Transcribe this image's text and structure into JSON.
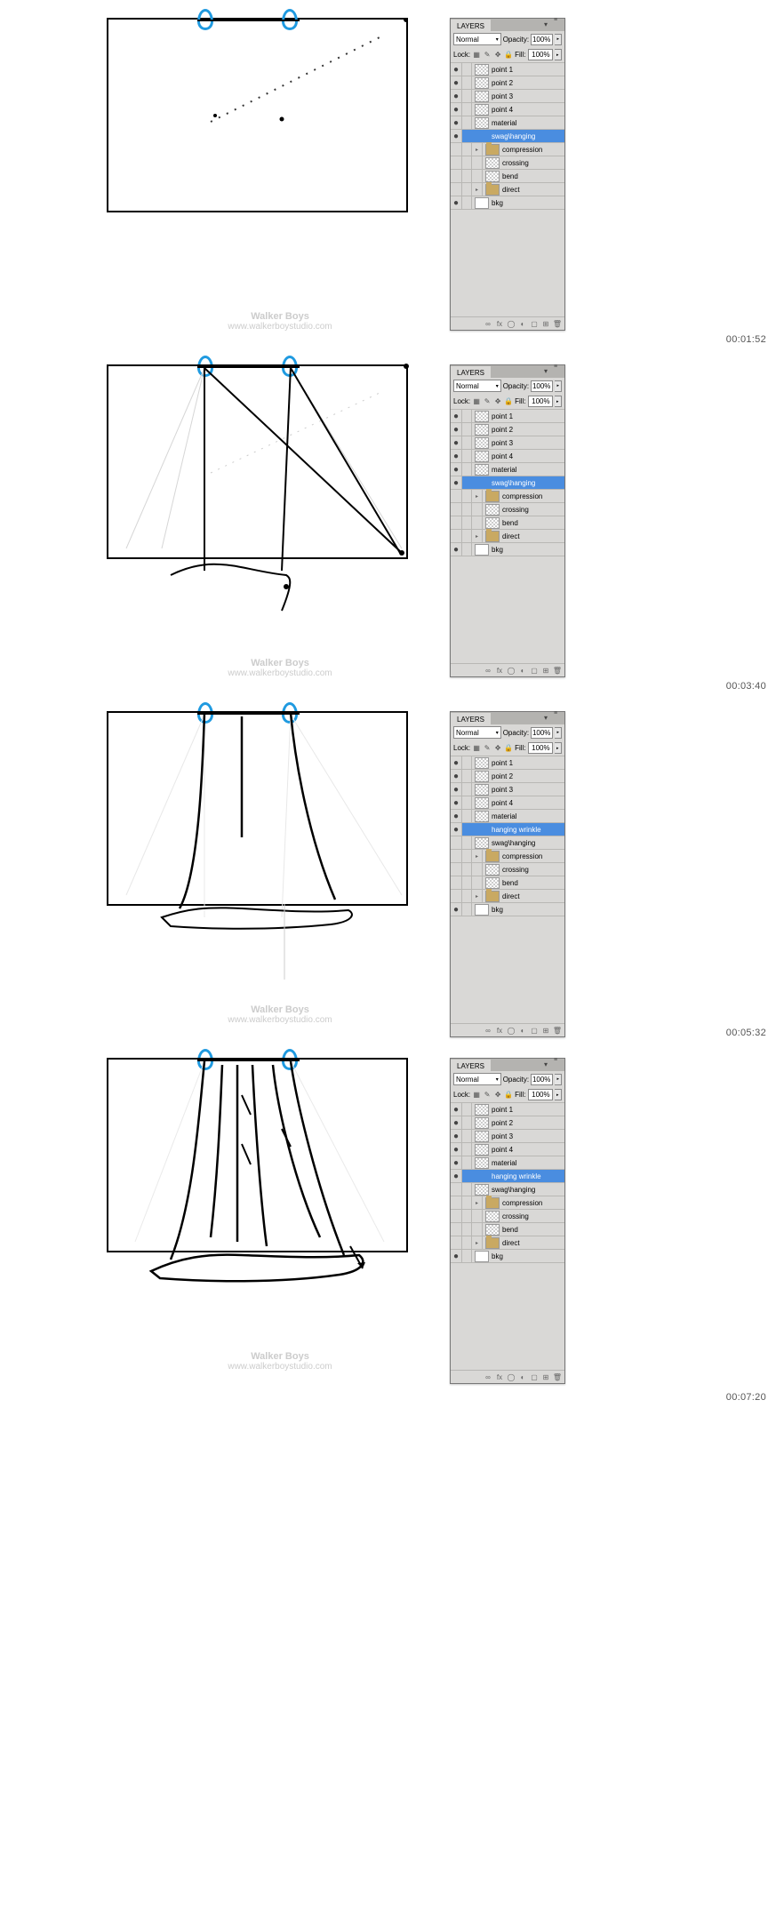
{
  "panel": {
    "tab_label": "LAYERS",
    "blend_mode": "Normal",
    "opacity_label": "Opacity:",
    "opacity_value": "100%",
    "lock_label": "Lock:",
    "fill_label": "Fill:",
    "fill_value": "100%"
  },
  "watermark": {
    "line1": "Walker Boys",
    "line2": "www.walkerboystudio.com"
  },
  "frame1": {
    "timestamp": "00:01:52",
    "layers": [
      {
        "vis": "●",
        "thumb": "checker",
        "name": "point 1",
        "indent": 0
      },
      {
        "vis": "●",
        "thumb": "checker",
        "name": "point 2",
        "indent": 0
      },
      {
        "vis": "●",
        "thumb": "checker",
        "name": "point 3",
        "indent": 0
      },
      {
        "vis": "●",
        "thumb": "checker",
        "name": "point 4",
        "indent": 0
      },
      {
        "vis": "●",
        "thumb": "checker",
        "name": "material",
        "indent": 0
      },
      {
        "vis": "●",
        "thumb": "checker-blue",
        "name": "swag\\hanging",
        "indent": 0,
        "selected": true
      },
      {
        "vis": "",
        "thumb": "folder",
        "name": "compression",
        "indent": 1,
        "arrow": "▸"
      },
      {
        "vis": "",
        "thumb": "checker",
        "name": "crossing",
        "indent": 1
      },
      {
        "vis": "",
        "thumb": "checker",
        "name": "bend",
        "indent": 1
      },
      {
        "vis": "",
        "thumb": "folder",
        "name": "direct",
        "indent": 1,
        "arrow": "▸"
      },
      {
        "vis": "●",
        "thumb": "white",
        "name": "bkg",
        "indent": 0
      }
    ]
  },
  "frame2": {
    "timestamp": "00:03:40",
    "layers": [
      {
        "vis": "●",
        "thumb": "checker",
        "name": "point 1",
        "indent": 0
      },
      {
        "vis": "●",
        "thumb": "checker",
        "name": "point 2",
        "indent": 0
      },
      {
        "vis": "●",
        "thumb": "checker",
        "name": "point 3",
        "indent": 0
      },
      {
        "vis": "●",
        "thumb": "checker",
        "name": "point 4",
        "indent": 0
      },
      {
        "vis": "●",
        "thumb": "checker",
        "name": "material",
        "indent": 0
      },
      {
        "vis": "●",
        "thumb": "checker-blue",
        "name": "swag\\hanging",
        "indent": 0,
        "selected": true
      },
      {
        "vis": "",
        "thumb": "folder",
        "name": "compression",
        "indent": 1,
        "arrow": "▸"
      },
      {
        "vis": "",
        "thumb": "checker",
        "name": "crossing",
        "indent": 1
      },
      {
        "vis": "",
        "thumb": "checker",
        "name": "bend",
        "indent": 1
      },
      {
        "vis": "",
        "thumb": "folder",
        "name": "direct",
        "indent": 1,
        "arrow": "▸"
      },
      {
        "vis": "●",
        "thumb": "white",
        "name": "bkg",
        "indent": 0
      }
    ]
  },
  "frame3": {
    "timestamp": "00:05:32",
    "layers": [
      {
        "vis": "●",
        "thumb": "checker",
        "name": "point 1",
        "indent": 0
      },
      {
        "vis": "●",
        "thumb": "checker",
        "name": "point 2",
        "indent": 0
      },
      {
        "vis": "●",
        "thumb": "checker",
        "name": "point 3",
        "indent": 0
      },
      {
        "vis": "●",
        "thumb": "checker",
        "name": "point 4",
        "indent": 0
      },
      {
        "vis": "●",
        "thumb": "checker",
        "name": "material",
        "indent": 0
      },
      {
        "vis": "●",
        "thumb": "checker-blue",
        "name": "hanging wrinkle",
        "indent": 0,
        "selected": true
      },
      {
        "vis": "",
        "thumb": "checker",
        "name": "swag\\hanging",
        "indent": 0
      },
      {
        "vis": "",
        "thumb": "folder",
        "name": "compression",
        "indent": 1,
        "arrow": "▸"
      },
      {
        "vis": "",
        "thumb": "checker",
        "name": "crossing",
        "indent": 1
      },
      {
        "vis": "",
        "thumb": "checker",
        "name": "bend",
        "indent": 1
      },
      {
        "vis": "",
        "thumb": "folder",
        "name": "direct",
        "indent": 1,
        "arrow": "▸"
      },
      {
        "vis": "●",
        "thumb": "white",
        "name": "bkg",
        "indent": 0
      }
    ]
  },
  "frame4": {
    "timestamp": "00:07:20",
    "layers": [
      {
        "vis": "●",
        "thumb": "checker",
        "name": "point 1",
        "indent": 0
      },
      {
        "vis": "●",
        "thumb": "checker",
        "name": "point 2",
        "indent": 0
      },
      {
        "vis": "●",
        "thumb": "checker",
        "name": "point 3",
        "indent": 0
      },
      {
        "vis": "●",
        "thumb": "checker",
        "name": "point 4",
        "indent": 0
      },
      {
        "vis": "●",
        "thumb": "checker",
        "name": "material",
        "indent": 0
      },
      {
        "vis": "●",
        "thumb": "checker-blue",
        "name": "hanging wrinkle",
        "indent": 0,
        "selected": true
      },
      {
        "vis": "",
        "thumb": "checker",
        "name": "swag\\hanging",
        "indent": 0
      },
      {
        "vis": "",
        "thumb": "folder",
        "name": "compression",
        "indent": 1,
        "arrow": "▸"
      },
      {
        "vis": "",
        "thumb": "checker",
        "name": "crossing",
        "indent": 1
      },
      {
        "vis": "",
        "thumb": "checker",
        "name": "bend",
        "indent": 1
      },
      {
        "vis": "",
        "thumb": "folder",
        "name": "direct",
        "indent": 1,
        "arrow": "▸"
      },
      {
        "vis": "●",
        "thumb": "white",
        "name": "bkg",
        "indent": 0
      }
    ]
  }
}
